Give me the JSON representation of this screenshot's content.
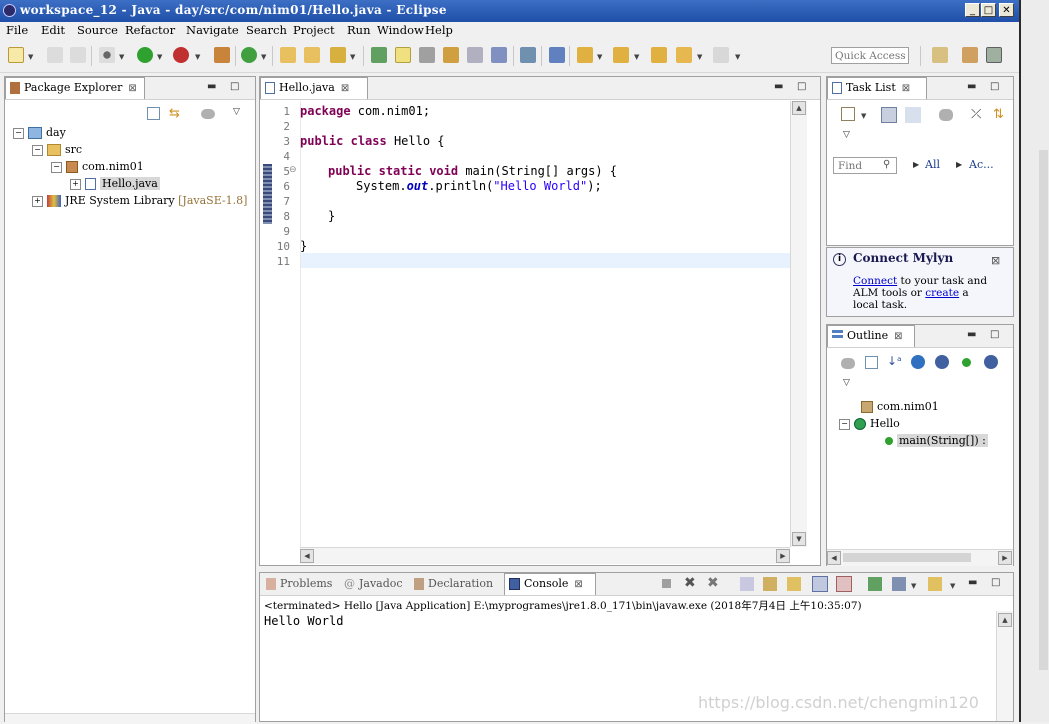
{
  "window": {
    "title": "workspace_12 - Java - day/src/com/nim01/Hello.java - Eclipse",
    "min_glyph": "_",
    "max_glyph": "□",
    "close_glyph": "✕"
  },
  "menu": [
    "File",
    "Edit",
    "Source",
    "Refactor",
    "Navigate",
    "Search",
    "Project",
    "Run",
    "Window",
    "Help"
  ],
  "toolbar": {
    "quick_access_placeholder": "Quick Access"
  },
  "package_explorer": {
    "tab_label": "Package Explorer",
    "tree": {
      "project": "day",
      "src": "src",
      "package": "com.nim01",
      "file": "Hello.java",
      "library": "JRE System Library",
      "library_suffix": "[JavaSE-1.8]"
    }
  },
  "editor": {
    "tab_label": "Hello.java",
    "lines": [
      "1",
      "2",
      "3",
      "4",
      "5",
      "6",
      "7",
      "8",
      "9",
      "10",
      "11"
    ],
    "code": {
      "l1_kw": "package",
      "l1_rest": " com.nim01;",
      "l3_kw1": "public",
      "l3_kw2": "class",
      "l3_rest": " Hello {",
      "l5_kw1": "public",
      "l5_kw2": "static",
      "l5_kw3": "void",
      "l5_rest": " main(String[] args) {",
      "l6_a": "System.",
      "l6_out": "out",
      "l6_b": ".println(",
      "l6_str": "\"Hello World\"",
      "l6_c": ");",
      "l8": "}",
      "l10": "}"
    }
  },
  "task_list": {
    "tab_label": "Task List",
    "find_placeholder": "Find",
    "filter_all": "All",
    "filter_ac": "Ac..."
  },
  "mylyn": {
    "title": "Connect Mylyn",
    "connect_link": "Connect",
    "text1": " to your task and",
    "text2": "ALM tools or ",
    "create_link": "create",
    "text3": " a",
    "text4": "local task."
  },
  "outline": {
    "tab_label": "Outline",
    "package": "com.nim01",
    "class": "Hello",
    "method": "main(String[]) :"
  },
  "bottom_tabs": {
    "problems": "Problems",
    "javadoc": "Javadoc",
    "declaration": "Declaration",
    "console": "Console"
  },
  "console": {
    "header": "<terminated> Hello [Java Application] E:\\myprogrames\\jre1.8.0_171\\bin\\javaw.exe (2018年7月4日 上午10:35:07)",
    "output": "Hello World"
  },
  "watermark": "https://blog.csdn.net/chengmin120",
  "colors": {
    "keyword": "#7f0055",
    "string": "#2a00ff",
    "titlebar": "#2456b3",
    "current_line": "#e8f2fe"
  }
}
